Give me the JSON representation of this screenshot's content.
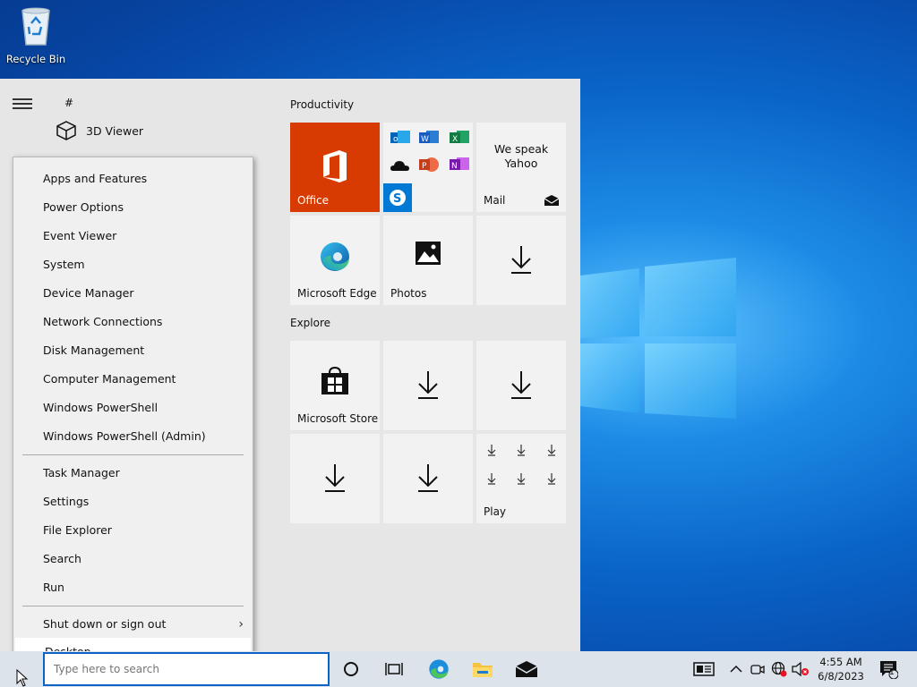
{
  "desktop": {
    "recycle_bin_label": "Recycle Bin"
  },
  "start_menu": {
    "hash_label": "#",
    "app_3d_viewer": "3D Viewer",
    "groups": {
      "productivity": "Productivity",
      "explore": "Explore"
    },
    "tiles": {
      "office": "Office",
      "mail": "Mail",
      "mail_promo": "We speak Yahoo",
      "edge": "Microsoft Edge",
      "photos": "Photos",
      "store": "Microsoft Store",
      "play": "Play"
    }
  },
  "context_menu": {
    "items": [
      "Apps and Features",
      "Power Options",
      "Event Viewer",
      "System",
      "Device Manager",
      "Network Connections",
      "Disk Management",
      "Computer Management",
      "Windows PowerShell",
      "Windows PowerShell (Admin)",
      "Task Manager",
      "Settings",
      "File Explorer",
      "Search",
      "Run",
      "Shut down or sign out",
      "Desktop"
    ],
    "selected": "Desktop"
  },
  "taskbar": {
    "search_placeholder": "Type here to search",
    "time": "4:55 AM",
    "date": "6/8/2023",
    "notification_count": "1"
  },
  "colors": {
    "office_tile": "#d83b01",
    "taskbar": "#dde3ea",
    "accent": "#0a64c8"
  }
}
